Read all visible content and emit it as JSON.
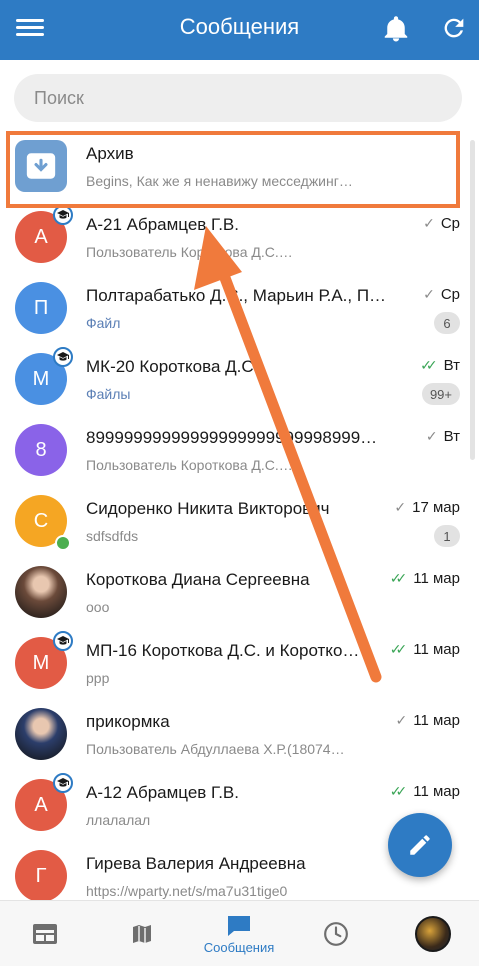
{
  "header": {
    "title": "Сообщения"
  },
  "search": {
    "placeholder": "Поиск"
  },
  "chats": [
    {
      "name": "Архив",
      "preview": "Begins, Как же я ненавижу месседжинг…",
      "avatar_text": "",
      "avatar_color": "#6f9fd1",
      "kind": "archive"
    },
    {
      "name": "А-21 Абрамцев Г.В.",
      "preview": "Пользователь Короткова Д.С.…",
      "time": "Ср",
      "check": "sent",
      "avatar_text": "А",
      "avatar_color": "#e25b45",
      "group": true
    },
    {
      "name": "Полтарабатько Д.С., Марьин Р.А., П…",
      "preview": "Файл",
      "preview_link": true,
      "time": "Ср",
      "check": "sent",
      "badge": "6",
      "avatar_text": "П",
      "avatar_color": "#4a90e2"
    },
    {
      "name": "МК-20 Короткова Д.С.",
      "preview": "Файлы",
      "preview_link": true,
      "time": "Вт",
      "check": "read",
      "badge": "99+",
      "avatar_text": "М",
      "avatar_color": "#4a90e2",
      "group": true
    },
    {
      "name": "89999999999999999999999998999…",
      "preview": "Пользователь Короткова Д.С.…",
      "time": "Вт",
      "check": "sent",
      "avatar_text": "8",
      "avatar_color": "#8a63e8"
    },
    {
      "name": "Сидоренко Никита Викторович",
      "preview": "sdfsdfds",
      "time": "17 мар",
      "check": "sent",
      "badge": "1",
      "avatar_text": "С",
      "avatar_color": "#f5a623",
      "online": true
    },
    {
      "name": "Короткова Диана Сергеевна",
      "preview": "ooo",
      "time": "11 мар",
      "check": "read",
      "avatar_text": "",
      "avatar_color": "#6b4a3a",
      "photo": true
    },
    {
      "name": "МП-16 Короткова Д.С. и Коротко…",
      "preview": "ppp",
      "time": "11 мар",
      "check": "read",
      "avatar_text": "М",
      "avatar_color": "#e25b45",
      "group": true
    },
    {
      "name": "прикормка",
      "preview": "Пользователь Абдуллаева Х.Р.(18074…",
      "time": "11 мар",
      "check": "sent",
      "avatar_text": "",
      "avatar_color": "#2c3e6b",
      "photo": true
    },
    {
      "name": "А-12 Абрамцев Г.В.",
      "preview": "ллалалал",
      "time": "11 мар",
      "check": "read",
      "avatar_text": "А",
      "avatar_color": "#e25b45",
      "group": true
    },
    {
      "name": "Гирева Валерия Андреевна",
      "preview": "https://wparty.net/s/ma7u31tige0",
      "time": "",
      "avatar_text": "Г",
      "avatar_color": "#e25b45"
    }
  ],
  "bottom_nav": [
    {
      "icon": "calendar-icon",
      "label": ""
    },
    {
      "icon": "map-icon",
      "label": ""
    },
    {
      "icon": "messages-icon",
      "label": "Сообщения"
    },
    {
      "icon": "clock-icon",
      "label": ""
    },
    {
      "icon": "profile-avatar-icon",
      "label": ""
    }
  ],
  "colors": {
    "primary": "#2e7bc4",
    "annotation": "#f07a3c",
    "read_check": "#3aa556"
  }
}
